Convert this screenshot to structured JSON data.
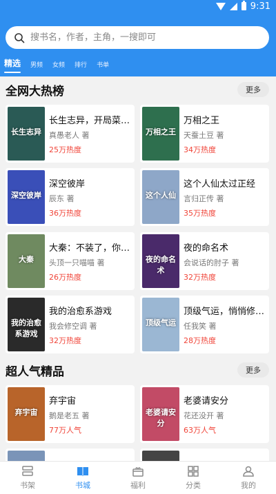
{
  "status": {
    "time": "9:31"
  },
  "search": {
    "placeholder": "搜书名，作者，主角，一搜即可"
  },
  "tabs": [
    {
      "label": "精选",
      "active": true
    },
    {
      "label": "男频"
    },
    {
      "label": "女频"
    },
    {
      "label": "排行"
    },
    {
      "label": "书单"
    }
  ],
  "section1": {
    "title": "全网大热榜",
    "more_label": "更多",
    "books": [
      {
        "title": "长生志异，开局菜…",
        "author": "真愚老人 著",
        "heat": "25万热度",
        "cover_text": "长生志异",
        "cover_color": "#2a5a55"
      },
      {
        "title": "万相之王",
        "author": "天蚕土豆 著",
        "heat": "34万热度",
        "cover_text": "万相之王",
        "cover_color": "#2e6f4e"
      },
      {
        "title": "深空彼岸",
        "author": "辰东 著",
        "heat": "36万热度",
        "cover_text": "深空彼岸",
        "cover_color": "#3a4fb8"
      },
      {
        "title": "这个人仙太过正经",
        "author": "言归正传 著",
        "heat": "35万热度",
        "cover_text": "这个人仙",
        "cover_color": "#8ea7c8"
      },
      {
        "title": "大秦：不装了，你…",
        "author": "头顶一只喵喵 著",
        "heat": "26万热度",
        "cover_text": "大秦",
        "cover_color": "#6f8a60"
      },
      {
        "title": "夜的命名术",
        "author": "会说话的肘子 著",
        "heat": "32万热度",
        "cover_text": "夜的命名术",
        "cover_color": "#4a2a6a"
      },
      {
        "title": "我的治愈系游戏",
        "author": "我会修空调 著",
        "heat": "32万热度",
        "cover_text": "我的治愈系游戏",
        "cover_color": "#2a2a2a"
      },
      {
        "title": "顶级气运，悄悄修…",
        "author": "任我笑 著",
        "heat": "28万热度",
        "cover_text": "顶级气运",
        "cover_color": "#9bb7d3"
      }
    ]
  },
  "section2": {
    "title": "超人气精品",
    "more_label": "更多",
    "books": [
      {
        "title": "弃宇宙",
        "author": "鹅是老五 著",
        "heat": "77万人气",
        "cover_text": "弃宇宙",
        "cover_color": "#b8642a"
      },
      {
        "title": "老婆请安分",
        "author": "花还没开 著",
        "heat": "63万人气",
        "cover_text": "老婆请安分",
        "cover_color": "#c24b66"
      }
    ]
  },
  "bottom_nav": [
    {
      "label": "书架",
      "icon": "bookshelf-icon"
    },
    {
      "label": "书城",
      "icon": "bookstore-icon",
      "active": true
    },
    {
      "label": "福利",
      "icon": "gift-icon"
    },
    {
      "label": "分类",
      "icon": "category-icon"
    },
    {
      "label": "我的",
      "icon": "profile-icon"
    }
  ],
  "colors": {
    "brand": "#2f8ff0",
    "heat": "#f04438",
    "background": "#f2f2f2"
  }
}
